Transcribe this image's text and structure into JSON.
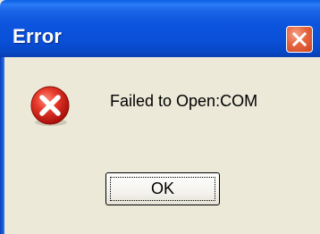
{
  "dialog": {
    "title": "Error",
    "message": "Failed to Open:COM",
    "icon": "error-icon",
    "ok_label": "OK",
    "close_icon": "close-icon"
  },
  "colors": {
    "titlebar": "#0a50d8",
    "dialog_background": "#ece9d8",
    "close_button": "#e5653f",
    "error_icon": "#d62a1e"
  }
}
